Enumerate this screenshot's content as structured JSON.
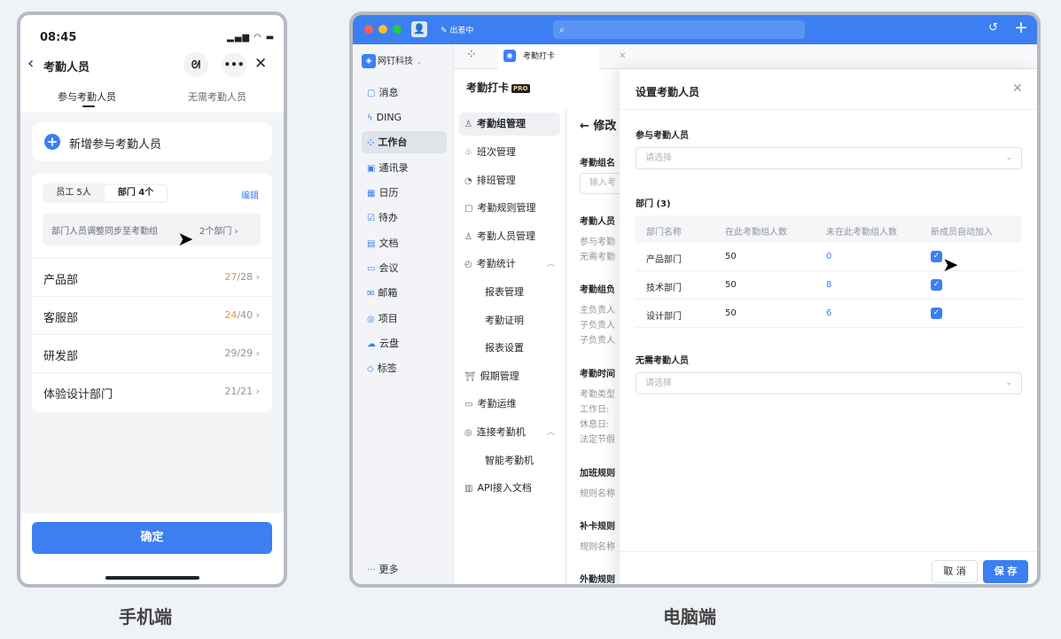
{
  "mobile": {
    "status_time": "08:45",
    "title": "考勤人员",
    "tabs": [
      "参与考勤人员",
      "无需考勤人员"
    ],
    "add_label": "新增参与考勤人员",
    "seg_employees": "员工 5人",
    "seg_departments": "部门 4个",
    "edit_label": "编辑",
    "sync_label": "部门人员调整同步至考勤组",
    "sync_count": "2个部门",
    "departments": [
      {
        "name": "产品部",
        "highlight": "27",
        "rest": "/28"
      },
      {
        "name": "客服部",
        "highlight": "24",
        "rest": "/40"
      },
      {
        "name": "研发部",
        "highlight": "",
        "rest": "29/29"
      },
      {
        "name": "体验设计部门",
        "highlight": "",
        "rest": "21/21"
      }
    ],
    "confirm_label": "确定",
    "caption": "手机端"
  },
  "desktop": {
    "status": "出差中",
    "org_name": "网钉科技",
    "nav": [
      {
        "icon": "message-icon",
        "label": "消息"
      },
      {
        "icon": "ding-icon",
        "label": "DING"
      },
      {
        "icon": "workbench-icon",
        "label": "工作台"
      },
      {
        "icon": "contacts-icon",
        "label": "通讯录"
      },
      {
        "icon": "calendar-icon",
        "label": "日历"
      },
      {
        "icon": "todo-icon",
        "label": "待办"
      },
      {
        "icon": "docs-icon",
        "label": "文档"
      },
      {
        "icon": "meeting-icon",
        "label": "会议"
      },
      {
        "icon": "mail-icon",
        "label": "邮箱"
      },
      {
        "icon": "project-icon",
        "label": "项目"
      },
      {
        "icon": "cloud-icon",
        "label": "云盘"
      },
      {
        "icon": "tag-icon",
        "label": "标签"
      }
    ],
    "more_label": "更多",
    "tab_label": "考勤打卡",
    "app_title": "考勤打卡",
    "pro_badge": "PRO",
    "menu": [
      "考勤组管理",
      "班次管理",
      "排班管理",
      "考勤规则管理",
      "考勤人员管理",
      "考勤统计",
      "报表管理",
      "考勤证明",
      "报表设置",
      "假期管理",
      "考勤运维",
      "连接考勤机",
      "智能考勤机",
      "API接入文档"
    ],
    "content": {
      "back_title": "修改",
      "group_name_label": "考勤组名",
      "group_name_placeholder": "输入考",
      "members_label": "考勤人员",
      "members_lines": [
        "参与考勤",
        "无需考勤"
      ],
      "owner_label": "考勤组负",
      "owner_lines": [
        "主负责人",
        "子负责人",
        "子负责人"
      ],
      "time_label": "考勤时间",
      "time_lines": [
        "考勤类型",
        "工作日:",
        "休息日:",
        "法定节假"
      ],
      "overtime_label": "加班规则",
      "overtime_line": "规则名称",
      "fix_label": "补卡规则",
      "fix_line": "规则名称",
      "out_label": "外勤规则"
    },
    "panel": {
      "title": "设置考勤人员",
      "participants_label": "参与考勤人员",
      "participants_placeholder": "请选择",
      "dept_label": "部门 (3)",
      "columns": [
        "部门名称",
        "在此考勤组人数",
        "未在此考勤组人数",
        "新成员自动加入"
      ],
      "rows": [
        {
          "name": "产品部门",
          "in": "50",
          "out": "0"
        },
        {
          "name": "技术部门",
          "in": "50",
          "out": "8"
        },
        {
          "name": "设计部门",
          "in": "50",
          "out": "6"
        }
      ],
      "exempt_label": "无需考勤人员",
      "exempt_placeholder": "请选择",
      "cancel_label": "取 消",
      "save_label": "保 存"
    },
    "caption": "电脑端"
  }
}
